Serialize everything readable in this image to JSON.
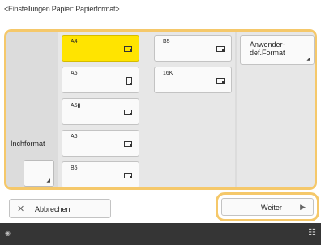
{
  "title": "<Einstellungen Papier: Papierformat>",
  "inch_format": {
    "label": "Inchformat",
    "arrow_icon": "corner-arrow-icon"
  },
  "paper_sizes": [
    {
      "label": "A4",
      "orientation": "landscape",
      "selected": true
    },
    {
      "label": "A5",
      "orientation": "portrait",
      "selected": false
    },
    {
      "label": "A5▮",
      "orientation": "landscape",
      "selected": false
    },
    {
      "label": "A6",
      "orientation": "landscape",
      "selected": false
    },
    {
      "label": "B5",
      "orientation": "landscape",
      "selected": false
    },
    {
      "label": "B5",
      "orientation": "landscape",
      "selected": false
    },
    {
      "label": "16K",
      "orientation": "landscape",
      "selected": false
    }
  ],
  "custom_format": {
    "label": "Anwender-\ndef.Format",
    "arrow_icon": "corner-arrow-icon"
  },
  "buttons": {
    "cancel_label": "Abbrechen",
    "next_label": "Weiter"
  },
  "status_bar": {
    "left_icon": "info-icon",
    "right_icon": "network-icon"
  },
  "colors": {
    "selected": "#ffe400",
    "highlight_border": "#f5c86a",
    "status_bar": "#353535"
  }
}
